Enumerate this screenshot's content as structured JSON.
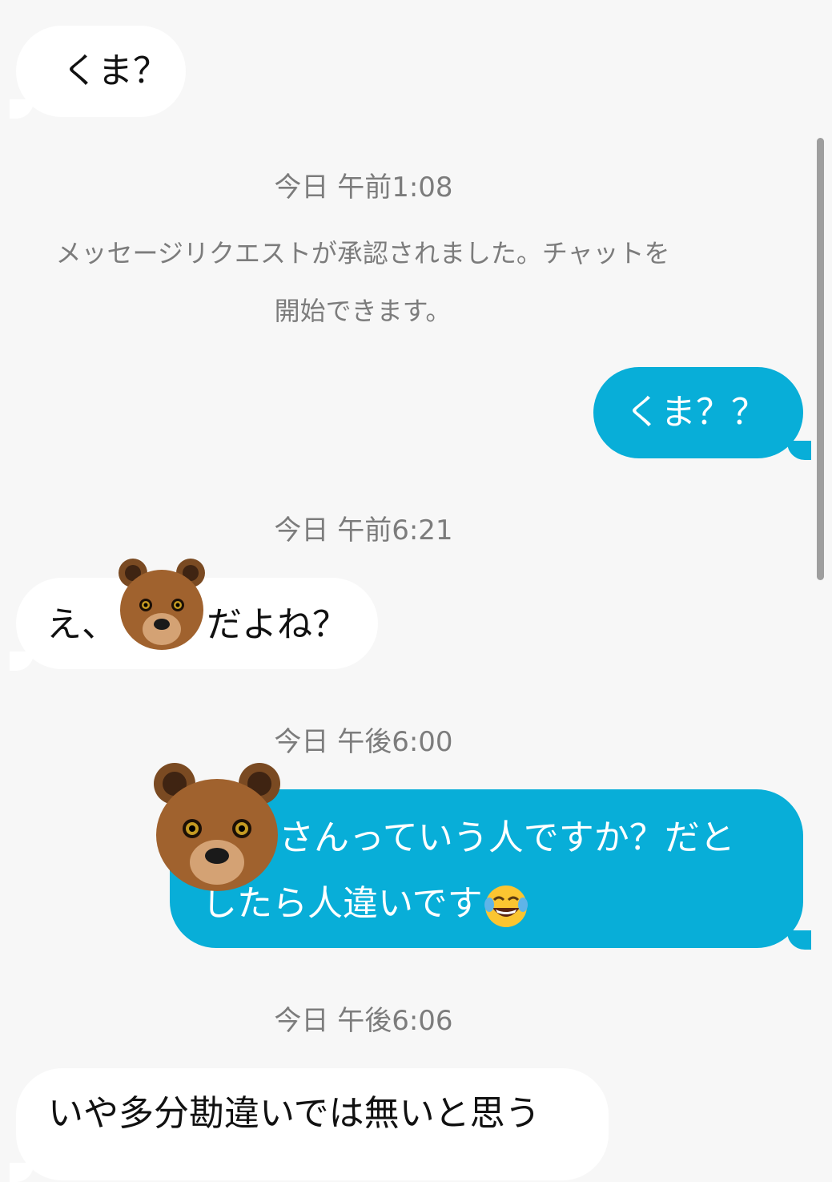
{
  "messages": {
    "m1": "くま？",
    "ts1": "今日 午前1:08",
    "system_line1": "メッセージリクエストが承認されました。チャットを",
    "system_line2": "開始できます。",
    "m2": "くま？？",
    "ts2": "今日 午前6:21",
    "m3_before": "え、",
    "m3_after": "だよね？",
    "ts3": "今日 午後6:00",
    "m4_line1": "さんっていう人ですか？だと",
    "m4_line2": "したら人違いです",
    "ts4": "今日 午後6:06",
    "m5": "いや多分勘違いでは無いと思う"
  },
  "icons": {
    "bear": "bear-face-emoji",
    "laugh": "face-with-tears-of-joy-emoji"
  },
  "colors": {
    "background": "#f7f7f7",
    "incoming_bubble": "#ffffff",
    "outgoing_bubble": "#08aed8",
    "timestamp_text": "#7c7c7c"
  }
}
